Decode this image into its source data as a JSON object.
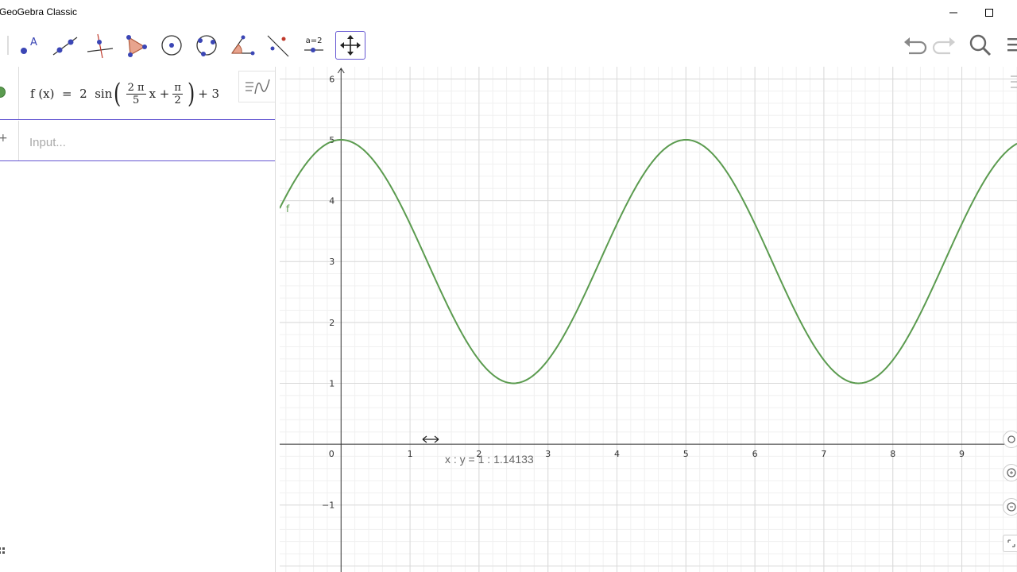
{
  "window": {
    "title": "GeoGebra Classic",
    "controls": [
      "minimize-icon",
      "maximize-icon"
    ]
  },
  "toolbar": {
    "tools": [
      {
        "name": "point-tool",
        "label": "A"
      },
      {
        "name": "line-tool"
      },
      {
        "name": "perpendicular-line-tool"
      },
      {
        "name": "polygon-tool"
      },
      {
        "name": "circle-center-point-tool"
      },
      {
        "name": "circle-three-points-tool"
      },
      {
        "name": "angle-tool"
      },
      {
        "name": "reflect-tool"
      },
      {
        "name": "slider-tool",
        "label": "a=2"
      },
      {
        "name": "move-graphics-view-tool",
        "selected": true
      }
    ],
    "right_icons": [
      "undo-icon",
      "redo-icon",
      "search-icon",
      "menu-icon"
    ]
  },
  "algebra": {
    "formula": {
      "prefix": "f (x)  =  2  sin",
      "frac1_num": "2 π",
      "frac1_den": "5",
      "middle": "x +",
      "frac2_num": "π",
      "frac2_den": "2",
      "suffix": "+ 3"
    },
    "input_placeholder": "Input..."
  },
  "graphics": {
    "function_label": "f",
    "status_text": "x : y = 1 : 1.14133",
    "curve_color": "#5b9b4f"
  },
  "chart_data": {
    "type": "line",
    "series": [
      {
        "name": "f",
        "expression": "2 sin(2π/5 x + π/2) + 3",
        "color": "#5b9b4f"
      }
    ],
    "x_ticks": [
      0,
      1,
      2,
      3,
      4,
      5,
      6,
      7,
      8,
      9
    ],
    "y_ticks": [
      -1,
      1,
      2,
      3,
      4,
      5,
      6
    ],
    "x_labels": [
      "0",
      "1",
      "2",
      "3",
      "4",
      "5",
      "6",
      "7",
      "8",
      "9"
    ],
    "y_labels": [
      "−1",
      "1",
      "2",
      "3",
      "4",
      "5",
      "6"
    ],
    "xlim": [
      -0.89,
      9.8
    ],
    "ylim": [
      -2.1,
      6.2
    ],
    "grid": true
  }
}
